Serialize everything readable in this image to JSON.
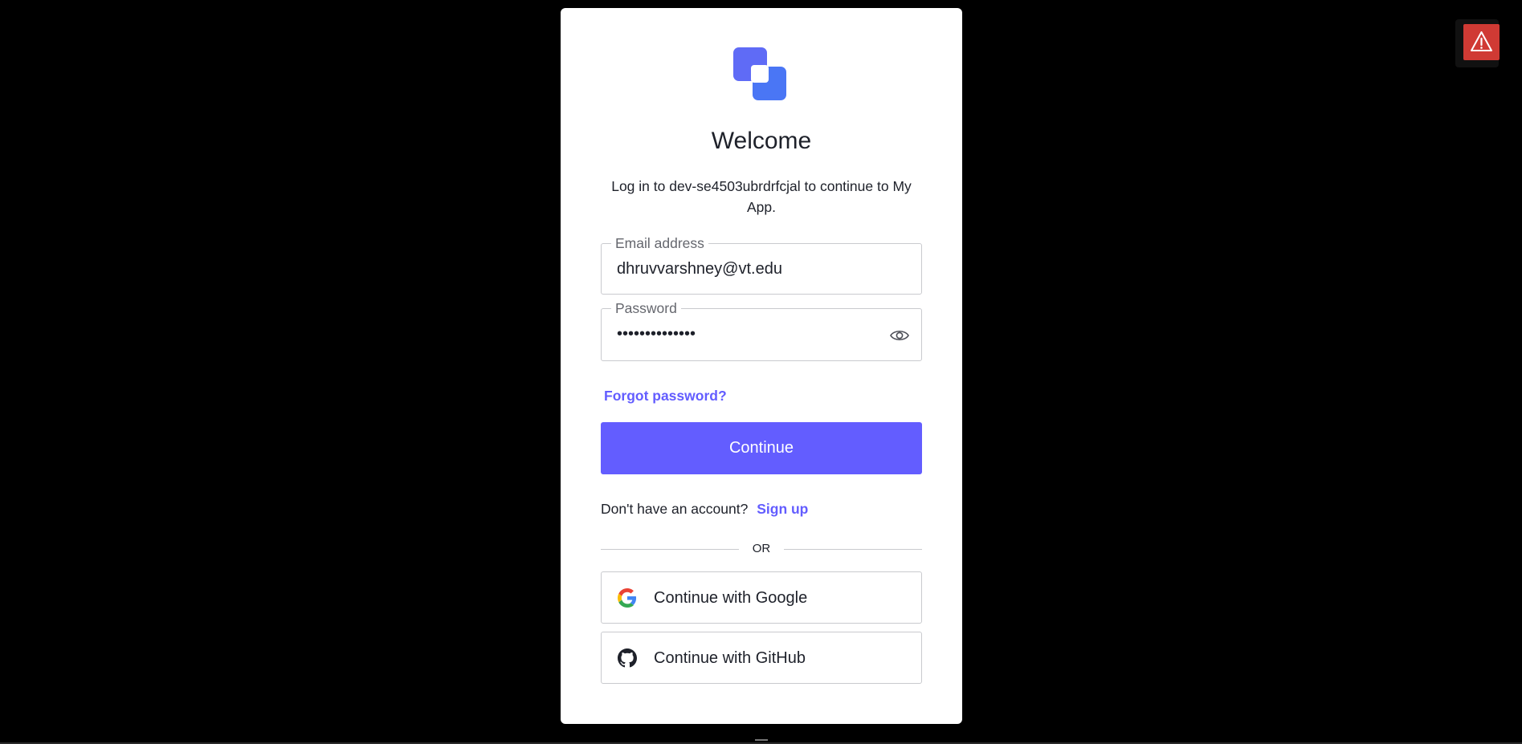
{
  "login": {
    "title": "Welcome",
    "subtitle": "Log in to dev-se4503ubrdrfcjal to continue to My App.",
    "email": {
      "label": "Email address",
      "value": "dhruvvarshney@vt.edu"
    },
    "password": {
      "label": "Password",
      "value": "••••••••••••••"
    },
    "forgot_password": "Forgot password?",
    "continue_label": "Continue",
    "signup_prompt": "Don't have an account?",
    "signup_link": "Sign up",
    "divider_text": "OR",
    "google_label": "Continue with Google",
    "github_label": "Continue with GitHub"
  },
  "colors": {
    "accent": "#635dff",
    "logo_primary": "#4f6ef7",
    "logo_secondary": "#6172f3",
    "warning": "#d03a34"
  },
  "icons": {
    "logo": "app-logo-icon",
    "password_toggle": "eye-icon",
    "google": "google-icon",
    "github": "github-icon",
    "warning": "warning-icon"
  }
}
